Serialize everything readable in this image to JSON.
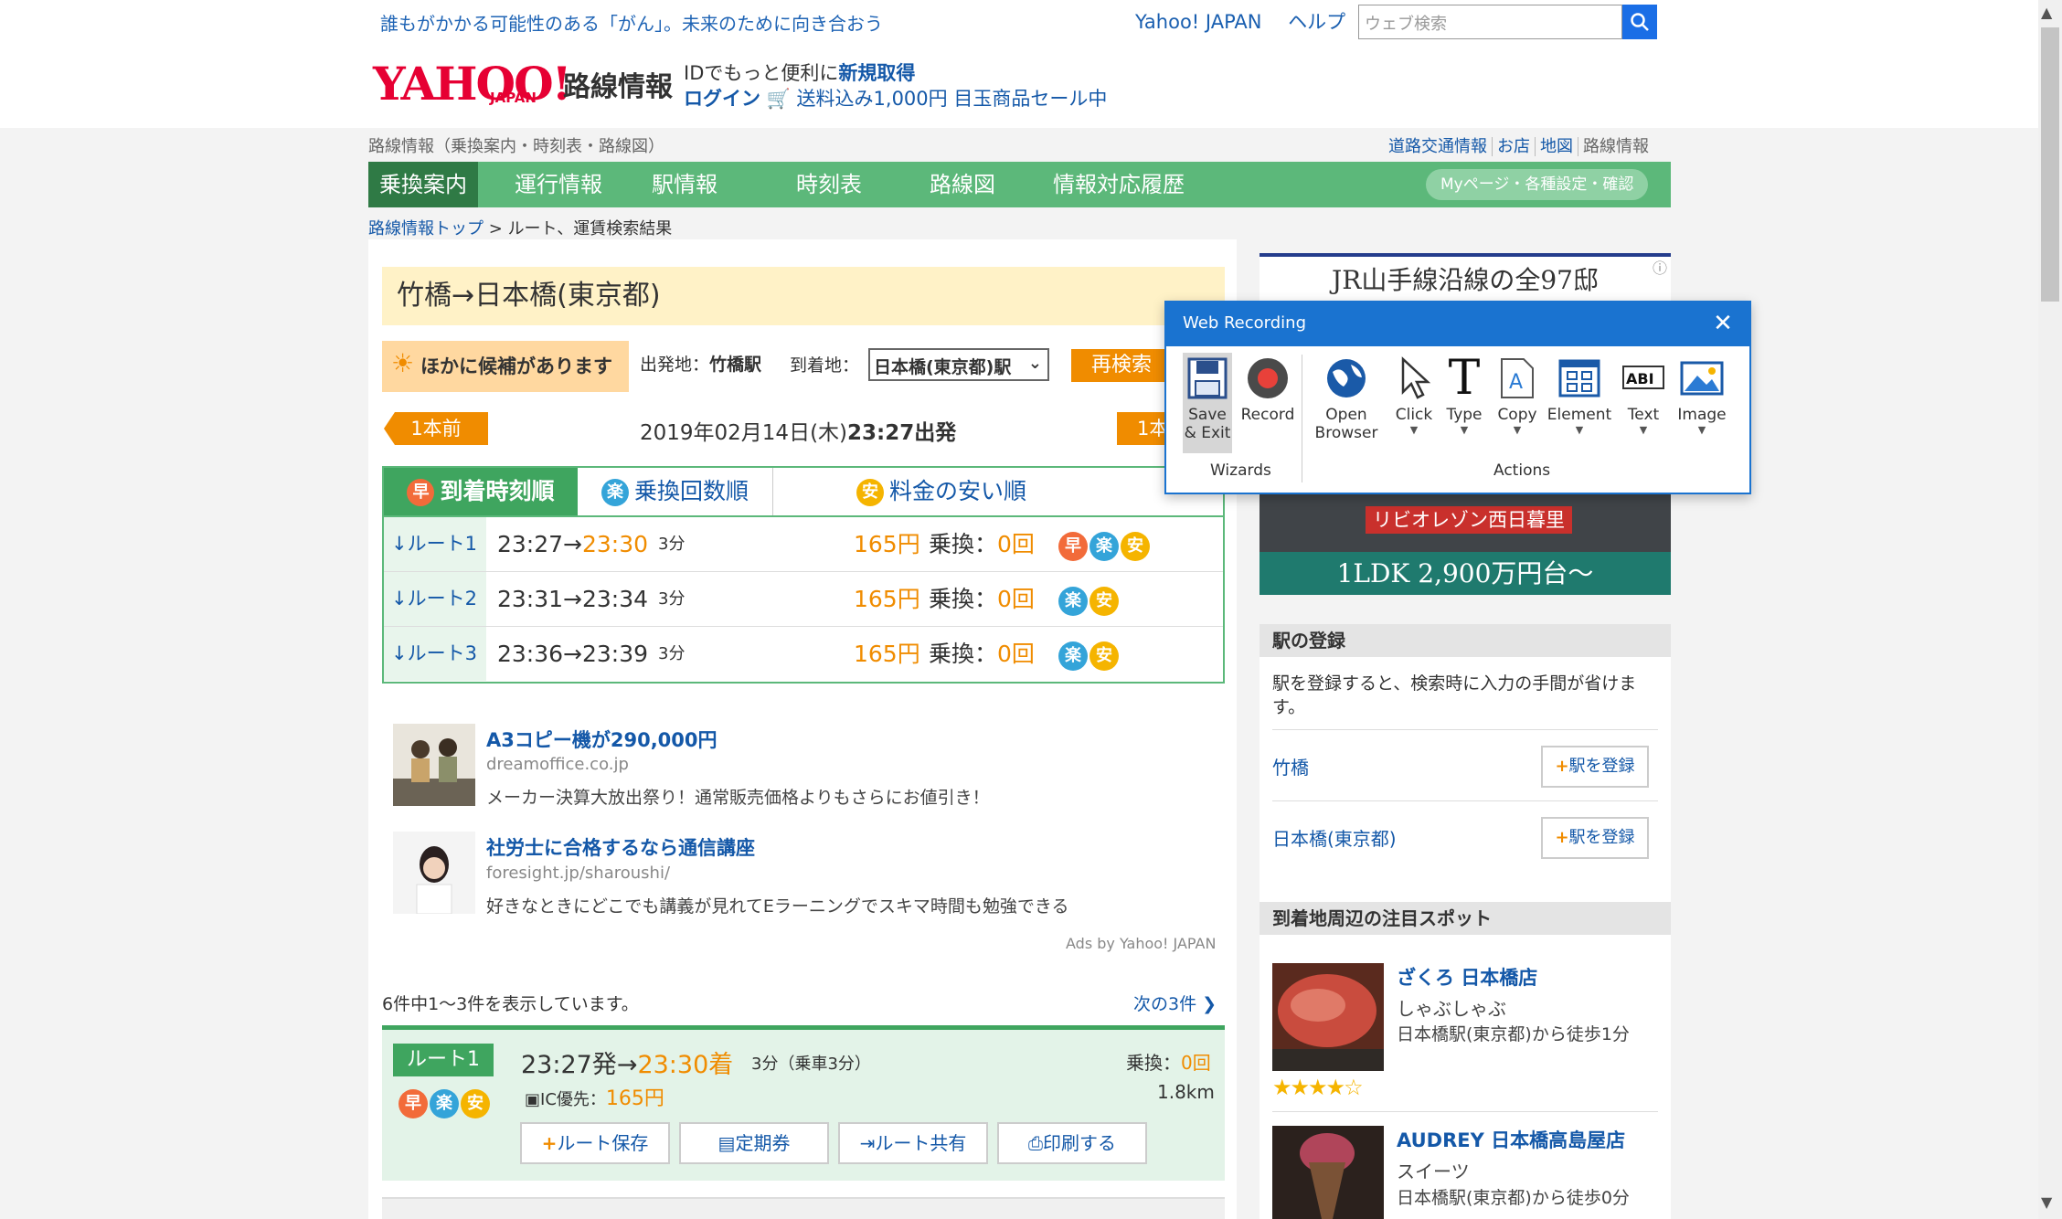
{
  "topbar": {
    "notice": "誰もがかかる可能性のある「がん」。未来のために向き合おう",
    "links": [
      "Yahoo! JAPAN",
      "ヘルプ"
    ],
    "search_placeholder": "ウェブ検索"
  },
  "header": {
    "logo": "YAHOO!",
    "logo_sub": "JAPAN",
    "service_name": "路線情報",
    "line1_prefix": "IDでもっと便利に",
    "line1_link": "新規取得",
    "login": "ログイン",
    "promo": "送料込み1,000円 目玉商品セール中"
  },
  "subheader": {
    "left": "路線情報（乗換案内・時刻表・路線図）",
    "right_links": [
      "道路交通情報",
      "お店",
      "地図",
      "路線情報"
    ]
  },
  "nav": {
    "tabs": [
      "乗換案内",
      "運行情報",
      "駅情報",
      "時刻表",
      "路線図",
      "情報対応履歴"
    ],
    "mypage": "Myページ・各種設定・確認"
  },
  "breadcrumb": {
    "top": "路線情報トップ",
    "sep": ">",
    "current": "ルート、運賃検索結果"
  },
  "search": {
    "title": "竹橋→日本橋(東京都)",
    "candidates": "ほかに候補があります",
    "dep_label": "出発地：",
    "dep_value": "竹橋駅",
    "arr_label": "到着地：",
    "arr_value": "日本橋(東京都)駅",
    "research": "再検索",
    "prev": "1本前",
    "next": "1本",
    "date": "2019年02月14日(木)",
    "time": "23:27出発"
  },
  "sort_tabs": [
    {
      "icon": "早",
      "label": "到着時刻順"
    },
    {
      "icon": "楽",
      "label": "乗換回数順"
    },
    {
      "icon": "安",
      "label": "料金の安い順"
    }
  ],
  "routes": [
    {
      "name": "ルート1",
      "dep": "23:27",
      "arrow": "→",
      "arr": "23:30",
      "dur": "3分",
      "fare": "165円",
      "xfer_label": "乗換：",
      "xfer": "0回",
      "icons": [
        "早",
        "楽",
        "安"
      ]
    },
    {
      "name": "ルート2",
      "dep": "23:31",
      "arrow": "→",
      "arr": "23:34",
      "dur": "3分",
      "fare": "165円",
      "xfer_label": "乗換：",
      "xfer": "0回",
      "icons": [
        "楽",
        "安"
      ]
    },
    {
      "name": "ルート3",
      "dep": "23:36",
      "arrow": "→",
      "arr": "23:39",
      "dur": "3分",
      "fare": "165円",
      "xfer_label": "乗換：",
      "xfer": "0回",
      "icons": [
        "楽",
        "安"
      ]
    }
  ],
  "ads": [
    {
      "title": "A3コピー機が290,000円",
      "url": "dreamoffice.co.jp",
      "desc": "メーカー決算大放出祭り！通常販売価格よりもさらにお値引き！"
    },
    {
      "title": "社労士に合格するなら通信講座",
      "url": "foresight.jp/sharoushi/",
      "desc": "好きなときにどこでも講義が見れてEラーニングでスキマ時間も勉強できる"
    }
  ],
  "ads_by": "Ads by Yahoo! JAPAN",
  "results": {
    "count": "6件中1～3件を表示しています。",
    "next": "次の3件"
  },
  "route_detail": {
    "label": "ルート1",
    "dep": "23:27発",
    "arrow": "→",
    "arr": "23:30着",
    "dur": "3分（乗車3分）",
    "xfer_label": "乗換：",
    "xfer": "0回",
    "ic_label": "IC優先：",
    "fare": "165円",
    "dist": "1.8km",
    "buttons": [
      "ルート保存",
      "定期券",
      "ルート共有",
      "印刷する"
    ]
  },
  "banner": {
    "top": "JR山手線沿線の全97邸",
    "red": "リビオレゾン西日暮里",
    "bottom": "1LDK  2,900万円台～"
  },
  "side": {
    "station_head": "駅の登録",
    "station_desc": "駅を登録すると、検索時に入力の手間が省けます。",
    "stations": [
      "竹橋",
      "日本橋(東京都)"
    ],
    "register_label": "駅を登録",
    "spots_head": "到着地周辺の注目スポット",
    "spots": [
      {
        "title": "ざくろ 日本橋店",
        "cat": "しゃぶしゃぶ",
        "walk": "日本橋駅(東京都)から徒歩1分"
      },
      {
        "title": "AUDREY 日本橋高島屋店",
        "cat": "スイーツ",
        "walk": "日本橋駅(東京都)から徒歩0分"
      }
    ],
    "stars": "★★★★☆"
  },
  "web_recording": {
    "title": "Web Recording",
    "tools": [
      {
        "label": "Save\n& Exit",
        "icon": "save-icon"
      },
      {
        "label": "Record",
        "icon": "record-icon"
      },
      {
        "label": "Open\nBrowser",
        "icon": "globe-icon"
      },
      {
        "label": "Click",
        "icon": "cursor-icon"
      },
      {
        "label": "Type",
        "icon": "type-icon"
      },
      {
        "label": "Copy",
        "icon": "copy-icon"
      },
      {
        "label": "Element",
        "icon": "element-icon"
      },
      {
        "label": "Text",
        "icon": "text-icon"
      },
      {
        "label": "Image",
        "icon": "image-icon"
      }
    ],
    "group_wizards": "Wizards",
    "group_actions": "Actions"
  },
  "colors": {
    "green": "#5cb87a",
    "green_dark": "#2f7a45",
    "orange": "#f08c00",
    "link": "#1458a8",
    "wr_blue": "#1a73d0"
  }
}
